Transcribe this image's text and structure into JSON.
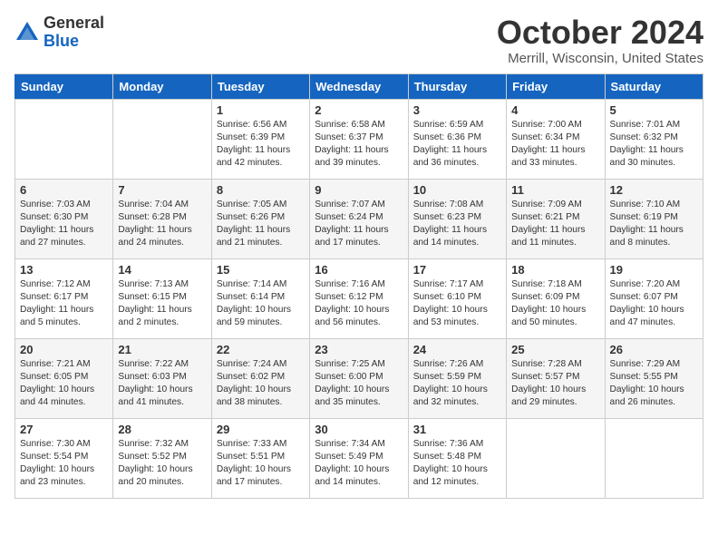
{
  "header": {
    "logo_general": "General",
    "logo_blue": "Blue",
    "month_title": "October 2024",
    "location": "Merrill, Wisconsin, United States"
  },
  "days_of_week": [
    "Sunday",
    "Monday",
    "Tuesday",
    "Wednesday",
    "Thursday",
    "Friday",
    "Saturday"
  ],
  "weeks": [
    [
      {
        "day": "",
        "content": ""
      },
      {
        "day": "",
        "content": ""
      },
      {
        "day": "1",
        "content": "Sunrise: 6:56 AM\nSunset: 6:39 PM\nDaylight: 11 hours and 42 minutes."
      },
      {
        "day": "2",
        "content": "Sunrise: 6:58 AM\nSunset: 6:37 PM\nDaylight: 11 hours and 39 minutes."
      },
      {
        "day": "3",
        "content": "Sunrise: 6:59 AM\nSunset: 6:36 PM\nDaylight: 11 hours and 36 minutes."
      },
      {
        "day": "4",
        "content": "Sunrise: 7:00 AM\nSunset: 6:34 PM\nDaylight: 11 hours and 33 minutes."
      },
      {
        "day": "5",
        "content": "Sunrise: 7:01 AM\nSunset: 6:32 PM\nDaylight: 11 hours and 30 minutes."
      }
    ],
    [
      {
        "day": "6",
        "content": "Sunrise: 7:03 AM\nSunset: 6:30 PM\nDaylight: 11 hours and 27 minutes."
      },
      {
        "day": "7",
        "content": "Sunrise: 7:04 AM\nSunset: 6:28 PM\nDaylight: 11 hours and 24 minutes."
      },
      {
        "day": "8",
        "content": "Sunrise: 7:05 AM\nSunset: 6:26 PM\nDaylight: 11 hours and 21 minutes."
      },
      {
        "day": "9",
        "content": "Sunrise: 7:07 AM\nSunset: 6:24 PM\nDaylight: 11 hours and 17 minutes."
      },
      {
        "day": "10",
        "content": "Sunrise: 7:08 AM\nSunset: 6:23 PM\nDaylight: 11 hours and 14 minutes."
      },
      {
        "day": "11",
        "content": "Sunrise: 7:09 AM\nSunset: 6:21 PM\nDaylight: 11 hours and 11 minutes."
      },
      {
        "day": "12",
        "content": "Sunrise: 7:10 AM\nSunset: 6:19 PM\nDaylight: 11 hours and 8 minutes."
      }
    ],
    [
      {
        "day": "13",
        "content": "Sunrise: 7:12 AM\nSunset: 6:17 PM\nDaylight: 11 hours and 5 minutes."
      },
      {
        "day": "14",
        "content": "Sunrise: 7:13 AM\nSunset: 6:15 PM\nDaylight: 11 hours and 2 minutes."
      },
      {
        "day": "15",
        "content": "Sunrise: 7:14 AM\nSunset: 6:14 PM\nDaylight: 10 hours and 59 minutes."
      },
      {
        "day": "16",
        "content": "Sunrise: 7:16 AM\nSunset: 6:12 PM\nDaylight: 10 hours and 56 minutes."
      },
      {
        "day": "17",
        "content": "Sunrise: 7:17 AM\nSunset: 6:10 PM\nDaylight: 10 hours and 53 minutes."
      },
      {
        "day": "18",
        "content": "Sunrise: 7:18 AM\nSunset: 6:09 PM\nDaylight: 10 hours and 50 minutes."
      },
      {
        "day": "19",
        "content": "Sunrise: 7:20 AM\nSunset: 6:07 PM\nDaylight: 10 hours and 47 minutes."
      }
    ],
    [
      {
        "day": "20",
        "content": "Sunrise: 7:21 AM\nSunset: 6:05 PM\nDaylight: 10 hours and 44 minutes."
      },
      {
        "day": "21",
        "content": "Sunrise: 7:22 AM\nSunset: 6:03 PM\nDaylight: 10 hours and 41 minutes."
      },
      {
        "day": "22",
        "content": "Sunrise: 7:24 AM\nSunset: 6:02 PM\nDaylight: 10 hours and 38 minutes."
      },
      {
        "day": "23",
        "content": "Sunrise: 7:25 AM\nSunset: 6:00 PM\nDaylight: 10 hours and 35 minutes."
      },
      {
        "day": "24",
        "content": "Sunrise: 7:26 AM\nSunset: 5:59 PM\nDaylight: 10 hours and 32 minutes."
      },
      {
        "day": "25",
        "content": "Sunrise: 7:28 AM\nSunset: 5:57 PM\nDaylight: 10 hours and 29 minutes."
      },
      {
        "day": "26",
        "content": "Sunrise: 7:29 AM\nSunset: 5:55 PM\nDaylight: 10 hours and 26 minutes."
      }
    ],
    [
      {
        "day": "27",
        "content": "Sunrise: 7:30 AM\nSunset: 5:54 PM\nDaylight: 10 hours and 23 minutes."
      },
      {
        "day": "28",
        "content": "Sunrise: 7:32 AM\nSunset: 5:52 PM\nDaylight: 10 hours and 20 minutes."
      },
      {
        "day": "29",
        "content": "Sunrise: 7:33 AM\nSunset: 5:51 PM\nDaylight: 10 hours and 17 minutes."
      },
      {
        "day": "30",
        "content": "Sunrise: 7:34 AM\nSunset: 5:49 PM\nDaylight: 10 hours and 14 minutes."
      },
      {
        "day": "31",
        "content": "Sunrise: 7:36 AM\nSunset: 5:48 PM\nDaylight: 10 hours and 12 minutes."
      },
      {
        "day": "",
        "content": ""
      },
      {
        "day": "",
        "content": ""
      }
    ]
  ]
}
